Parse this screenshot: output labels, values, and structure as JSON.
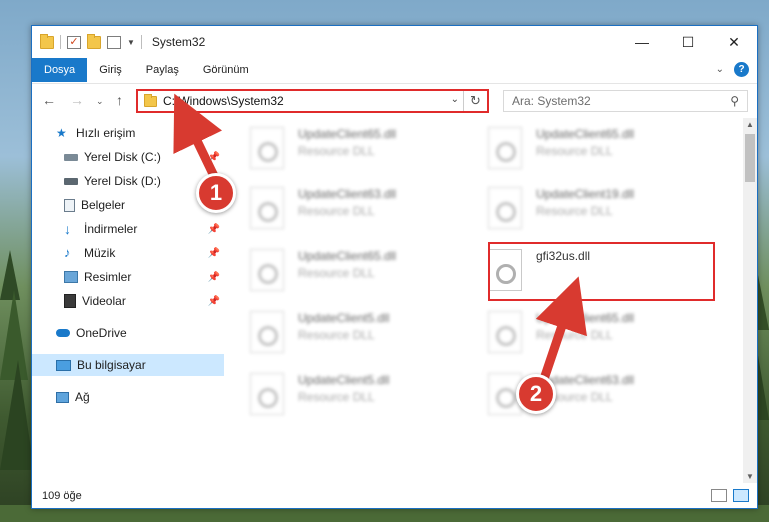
{
  "window": {
    "title": "System32",
    "icons": [
      "folder-icon",
      "checkbox-icon",
      "folder-icon",
      "properties-icon"
    ]
  },
  "ribbon": {
    "tabs": [
      {
        "label": "Dosya",
        "active": true
      },
      {
        "label": "Giriş",
        "active": false
      },
      {
        "label": "Paylaş",
        "active": false
      },
      {
        "label": "Görünüm",
        "active": false
      }
    ],
    "accent": "#1979ca"
  },
  "nav": {
    "address": "C:\\Windows\\System32",
    "search_placeholder": "Ara: System32"
  },
  "sidebar": {
    "items": [
      {
        "label": "Hızlı erişim",
        "icon": "star-icon",
        "pinned": false
      },
      {
        "label": "Yerel Disk (C:)",
        "icon": "drive-icon",
        "pinned": true
      },
      {
        "label": "Yerel Disk (D:)",
        "icon": "drive-icon",
        "pinned": false
      },
      {
        "label": "Belgeler",
        "icon": "documents-icon",
        "pinned": true
      },
      {
        "label": "İndirmeler",
        "icon": "download-icon",
        "pinned": true
      },
      {
        "label": "Müzik",
        "icon": "music-icon",
        "pinned": true
      },
      {
        "label": "Resimler",
        "icon": "pictures-icon",
        "pinned": true
      },
      {
        "label": "Videolar",
        "icon": "video-icon",
        "pinned": true
      },
      {
        "label": "OneDrive",
        "icon": "cloud-icon",
        "pinned": false
      },
      {
        "label": "Bu bilgisayar",
        "icon": "computer-icon",
        "pinned": false,
        "selected": true
      },
      {
        "label": "Ağ",
        "icon": "network-icon",
        "pinned": false
      }
    ]
  },
  "files": [
    {
      "name": "UpdateClient65.dll",
      "type": "Resource DLL",
      "blurred": true
    },
    {
      "name": "UpdateClient65.dll",
      "type": "Resource DLL",
      "blurred": true
    },
    {
      "name": "UpdateClient63.dll",
      "type": "Resource DLL",
      "blurred": true
    },
    {
      "name": "UpdateClient19.dll",
      "type": "Resource DLL",
      "blurred": true
    },
    {
      "name": "UpdateClient65.dll",
      "type": "Resource DLL",
      "blurred": true
    },
    {
      "name": "gfi32us.dll",
      "type": "",
      "blurred": false,
      "highlighted": true
    },
    {
      "name": "UpdateClient5.dll",
      "type": "Resource DLL",
      "blurred": true
    },
    {
      "name": "UpdateClient65.dll",
      "type": "Resource DLL",
      "blurred": true
    },
    {
      "name": "UpdateClient5.dll",
      "type": "Resource DLL",
      "blurred": true
    },
    {
      "name": "UpdateClient63.dll",
      "type": "Resource DLL",
      "blurred": true
    }
  ],
  "status": {
    "item_count": "109 öğe"
  },
  "callouts": [
    {
      "number": "1",
      "color": "#d83a30"
    },
    {
      "number": "2",
      "color": "#d83a30"
    }
  ]
}
